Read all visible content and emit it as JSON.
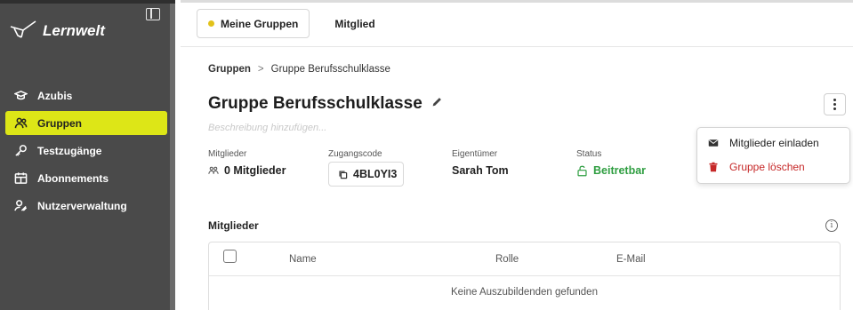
{
  "brand": {
    "name": "Lernwelt"
  },
  "sidebar": {
    "items": [
      {
        "label": "Azubis",
        "icon": "graduation-cap-icon",
        "active": false
      },
      {
        "label": "Gruppen",
        "icon": "users-icon",
        "active": true
      },
      {
        "label": "Testzugänge",
        "icon": "key-icon",
        "active": false
      },
      {
        "label": "Abonnements",
        "icon": "calendar-icon",
        "active": false
      },
      {
        "label": "Nutzerverwaltung",
        "icon": "user-cog-icon",
        "active": false
      }
    ]
  },
  "tabs": [
    {
      "label": "Meine Gruppen",
      "active": true
    },
    {
      "label": "Mitglied",
      "active": false
    }
  ],
  "breadcrumb": {
    "root": "Gruppen",
    "separator": ">",
    "current": "Gruppe Berufsschulklasse"
  },
  "group": {
    "title": "Gruppe Berufsschulklasse",
    "description_placeholder": "Beschreibung hinzufügen...",
    "members_label": "Mitglieder",
    "members_value": "0 Mitglieder",
    "code_label": "Zugangscode",
    "code_value": "4BL0YI3",
    "owner_label": "Eigentümer",
    "owner_value": "Sarah Tom",
    "status_label": "Status",
    "status_value": "Beitretbar"
  },
  "members_section": {
    "title": "Mitglieder",
    "columns": [
      "Name",
      "Rolle",
      "E-Mail"
    ],
    "empty_message": "Keine Auszubildenden gefunden"
  },
  "menu": {
    "items": [
      {
        "label": "Mitglieder einladen",
        "icon": "envelope-icon"
      },
      {
        "label": "Gruppe löschen",
        "icon": "trash-icon"
      }
    ]
  },
  "colors": {
    "sidebar_bg": "#4a4a4a",
    "accent": "#dde617",
    "status_green": "#2f9e41",
    "danger_red": "#c62828",
    "tab_dot": "#e2c21a"
  }
}
